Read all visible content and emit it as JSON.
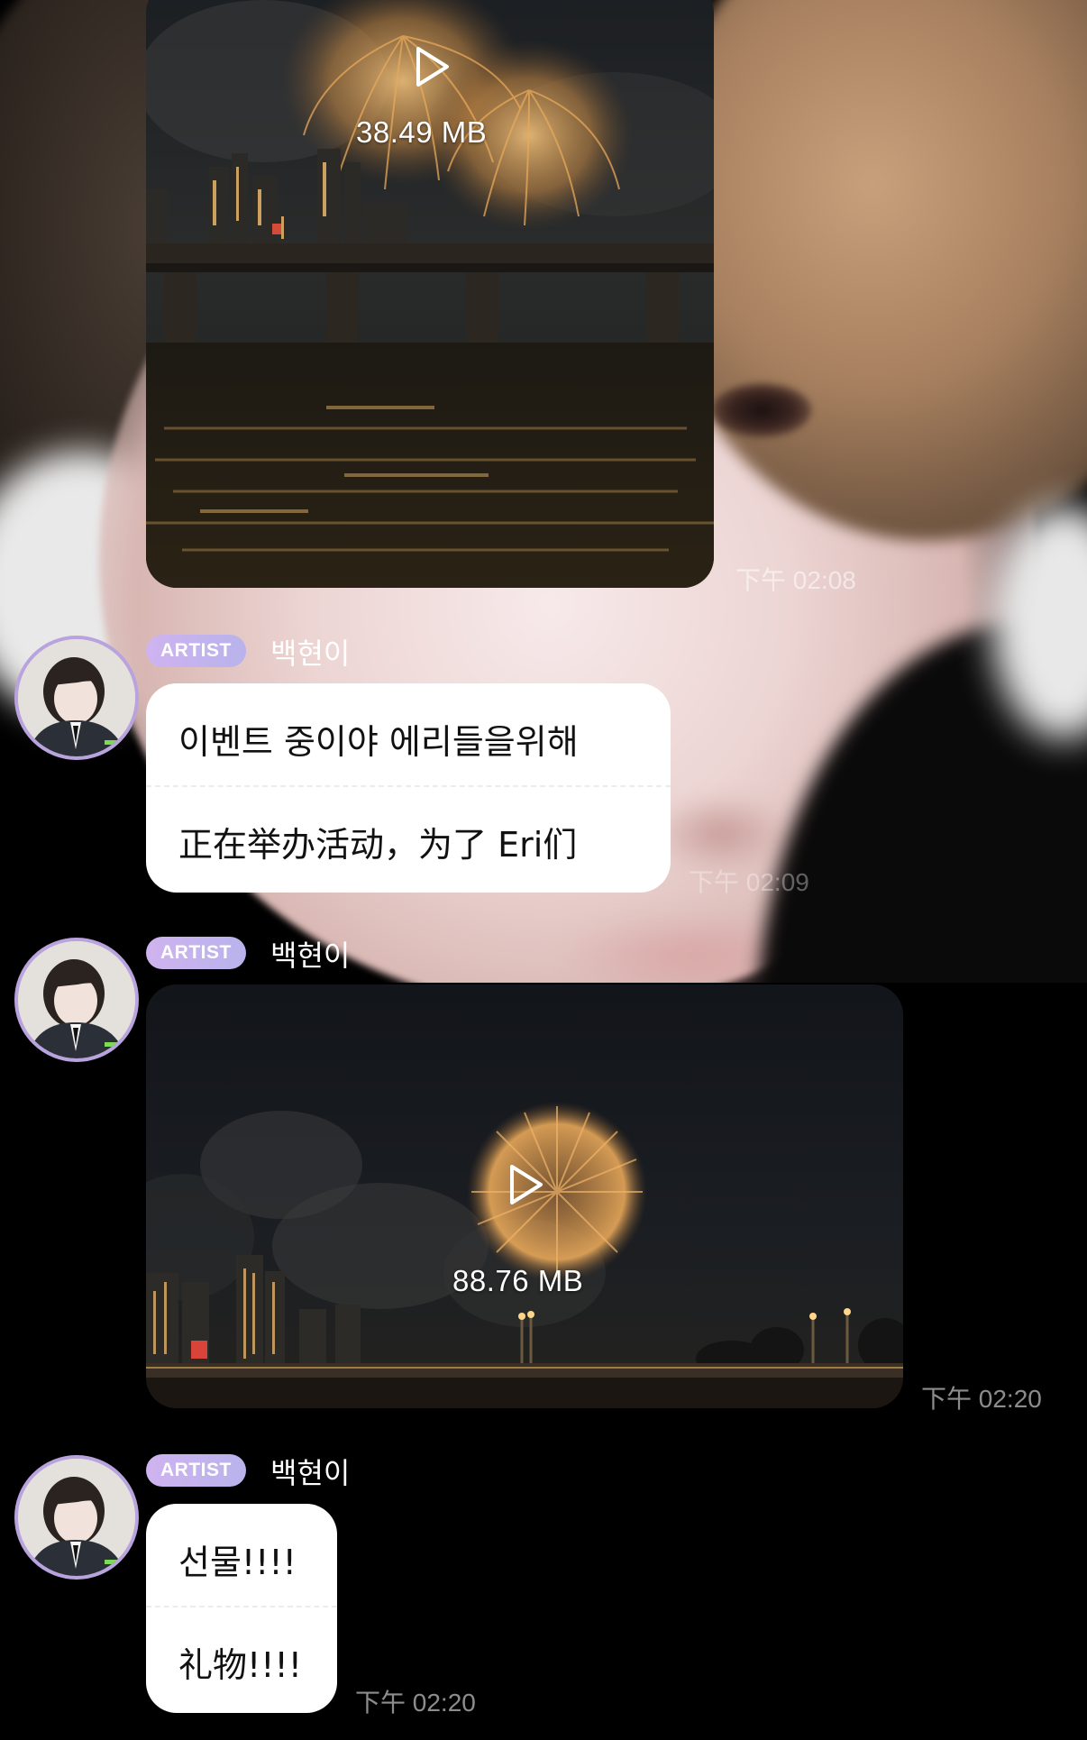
{
  "messages": [
    {
      "type": "video",
      "size": "38.49 MB",
      "time": "下午 02:08"
    },
    {
      "type": "text",
      "badge": "ARTIST",
      "sender": "백현이",
      "original": "이벤트 중이야 에리들을위해",
      "translation": "正在举办活动，为了 Eri们",
      "time": "下午 02:09"
    },
    {
      "type": "video",
      "badge": "ARTIST",
      "sender": "백현이",
      "size": "88.76 MB",
      "time": "下午 02:20"
    },
    {
      "type": "text",
      "badge": "ARTIST",
      "sender": "백현이",
      "original": "선물!!!!",
      "translation": "礼物!!!!",
      "time": "下午 02:20"
    }
  ],
  "colors": {
    "badge": "#c6b3ee",
    "avatar_ring": "#b9a3de",
    "bubble": "#ffffff",
    "firework": "#e8a95a"
  },
  "icons": [
    "play-icon"
  ]
}
